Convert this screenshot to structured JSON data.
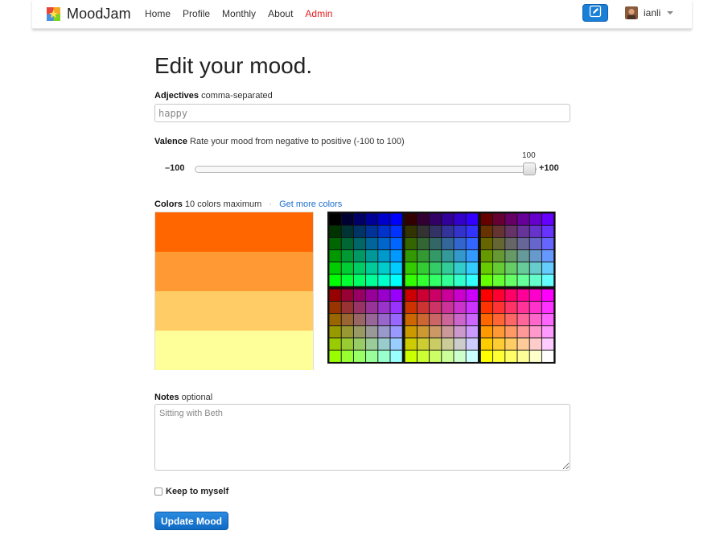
{
  "nav": {
    "brand": "MoodJam",
    "links": [
      {
        "label": "Home"
      },
      {
        "label": "Profile"
      },
      {
        "label": "Monthly"
      },
      {
        "label": "About"
      },
      {
        "label": "Admin",
        "color": "#e02020"
      }
    ],
    "compose_icon": "pencil-icon",
    "username": "ianli"
  },
  "page": {
    "title": "Edit your mood."
  },
  "adjectives": {
    "label": "Adjectives",
    "hint": "comma-separated",
    "value": "happy"
  },
  "valence": {
    "label": "Valence",
    "hint": "Rate your mood from negative to positive (-100 to 100)",
    "value": 100,
    "value_label": "100",
    "min_label": "–100",
    "max_label": "+100",
    "range": [
      -100,
      100
    ]
  },
  "colors": {
    "label": "Colors",
    "hint": "10 colors maximum",
    "separator": "·",
    "more_link": "Get more colors",
    "selected": [
      "#ff6600",
      "#ff9933",
      "#ffcc66",
      "#ffff99"
    ]
  },
  "notes": {
    "label": "Notes",
    "hint": "optional",
    "value": "Sitting with Beth"
  },
  "private": {
    "label": "Keep to myself",
    "checked": false
  },
  "submit": {
    "label": "Update Mood"
  }
}
